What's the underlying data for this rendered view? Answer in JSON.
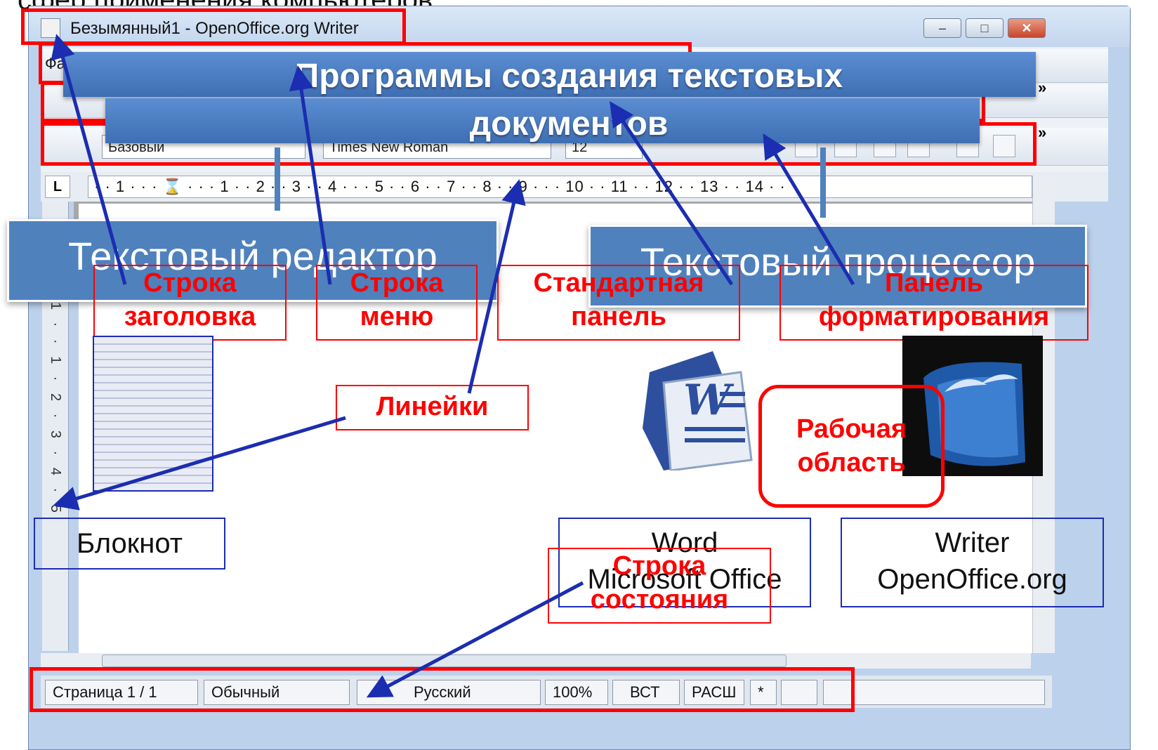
{
  "slide": {
    "top_text": "сфер применения компьютеров.",
    "heading_line1": "Программы создания текстовых",
    "heading_line2": "документов"
  },
  "window": {
    "title": "Безымянный1 - OpenOffice.org Writer",
    "controls": {
      "minimize": "–",
      "maximize": "□",
      "close": "✕"
    },
    "menu_first_letter": "Фа",
    "toolbar_more": "»"
  },
  "format_bar": {
    "style": "Базовый",
    "font": "Times New Roman",
    "size": "12"
  },
  "ruler": {
    "corner": "L",
    "scale": "· · 1 · · · ⌛ · · · 1 · · 2 · · 3 · · 4 · · · 5 · · 6 · · 7 · · 8 · · 9 · · · 10 · · 11 · · 12 · · 13 · · 14 · ·",
    "vertical_scale": "1 · · 1 · 2 · 3 · 4 · 5"
  },
  "statusbar": {
    "page": "Страница 1 / 1",
    "style": "Обычный",
    "language": "Русский",
    "zoom": "100%",
    "insert": "ВСТ",
    "extend": "РАСШ",
    "modified": "*"
  },
  "callouts": {
    "text_editor": "Текстовый редактор",
    "word_processor": "Текстовый процессор",
    "title_bar_1": "Строка",
    "title_bar_2": "заголовка",
    "menu_bar_1": "Строка",
    "menu_bar_2": "меню",
    "standard_panel_1": "Стандартная",
    "standard_panel_2": "панель",
    "format_panel_1": "Панель",
    "format_panel_2": "форматирования",
    "rulers": "Линейки",
    "work_area_1": "Рабочая",
    "work_area_2": "область",
    "status_bar_1": "Строка",
    "status_bar_2": "состояния",
    "notepad": "Блокнот",
    "word_1": "Word",
    "word_2": "Microsoft Office",
    "writer_1": "Writer",
    "writer_2": "OpenOffice.org"
  },
  "colors": {
    "highlight_red": "#ff0000",
    "arrow_blue": "#1b2db0",
    "callout_blue": "#4f81bd"
  }
}
